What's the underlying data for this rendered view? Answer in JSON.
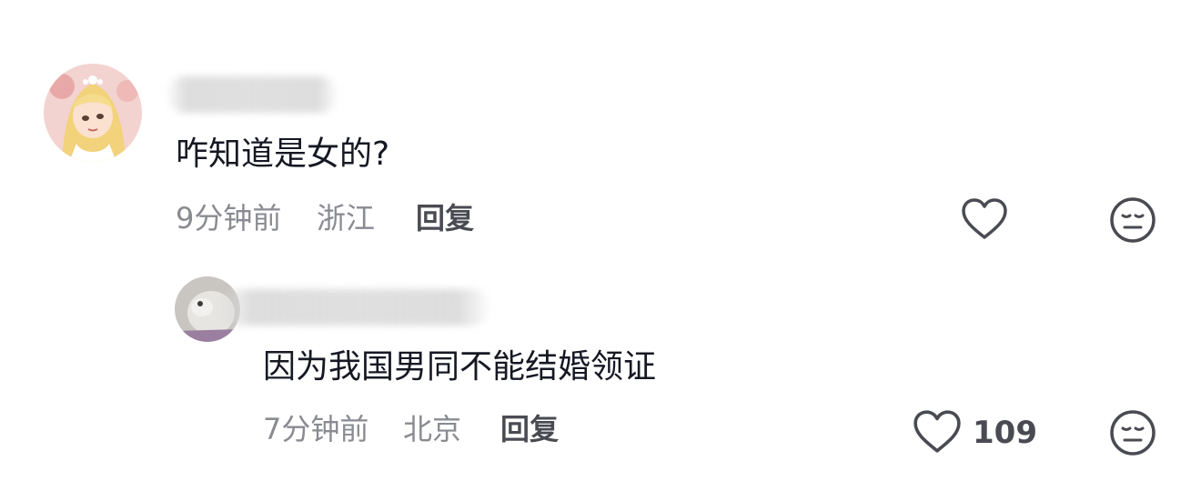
{
  "comments": [
    {
      "text": "咋知道是女的?",
      "time": "9分钟前",
      "location": "浙江",
      "reply_label": "回复"
    },
    {
      "text": "因为我国男同不能结婚领证",
      "time": "7分钟前",
      "location": "北京",
      "reply_label": "回复",
      "like_count": "109"
    }
  ]
}
